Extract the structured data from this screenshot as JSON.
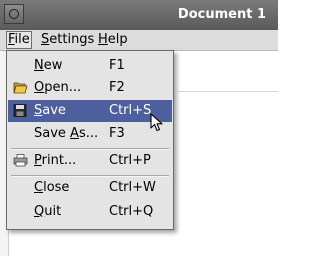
{
  "window": {
    "title": "Document 1"
  },
  "menubar": {
    "file": "File",
    "settings": "Settings",
    "help": "Help"
  },
  "file_menu": {
    "items": [
      {
        "label": "New",
        "shortcut": "F1",
        "icon": ""
      },
      {
        "label": "Open...",
        "shortcut": "F2",
        "icon": "folder-open-icon"
      },
      {
        "label": "Save",
        "shortcut": "Ctrl+S",
        "icon": "floppy-disk-icon",
        "highlighted": true
      },
      {
        "label": "Save As...",
        "shortcut": "F3",
        "icon": ""
      },
      {
        "label": "Print...",
        "shortcut": "Ctrl+P",
        "icon": "printer-icon"
      },
      {
        "label": "Close",
        "shortcut": "Ctrl+W",
        "icon": ""
      },
      {
        "label": "Quit",
        "shortcut": "Ctrl+Q",
        "icon": ""
      }
    ]
  },
  "colors": {
    "highlight": "#4d5f9d",
    "menu_bg": "#e4e4e4",
    "titlebar": "#6a6a6a"
  }
}
